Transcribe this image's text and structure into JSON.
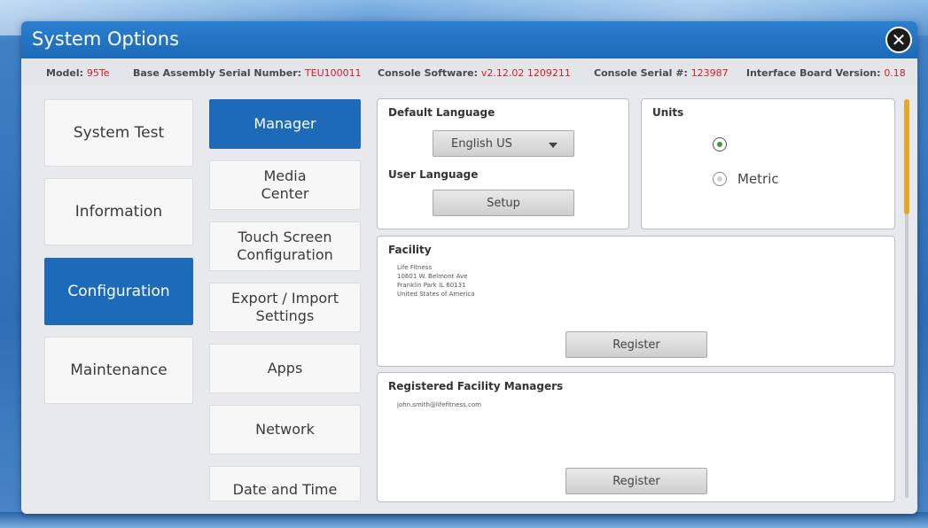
{
  "window": {
    "title": "System Options",
    "close_glyph": "✕"
  },
  "info": {
    "model_label": "Model: ",
    "model_value": "95Te",
    "serial_label": "Base Assembly Serial Number: ",
    "serial_value": "TEU100011",
    "software_label": "Console Software: ",
    "software_value": "v2.12.02 1209211",
    "console_serial_label": "Console Serial #: ",
    "console_serial_value": "123987",
    "interface_label": "Interface Board Version: ",
    "interface_value": "0.18"
  },
  "left_menu": [
    {
      "label": "System Test"
    },
    {
      "label": "Information"
    },
    {
      "label": "Configuration",
      "active": true
    },
    {
      "label": "Maintenance"
    }
  ],
  "sub_menu": [
    {
      "label": "Manager",
      "active": true
    },
    {
      "label": "Media\nCenter"
    },
    {
      "label": "Touch Screen\nConfiguration"
    },
    {
      "label": "Export / Import\nSettings"
    },
    {
      "label": "Apps"
    },
    {
      "label": "Network"
    },
    {
      "label": "Date and Time"
    }
  ],
  "language": {
    "default_title": "Default Language",
    "selected": "English US",
    "user_title": "User Language",
    "setup_label": "Setup"
  },
  "units": {
    "title": "Units",
    "metric_label": "Metric",
    "selected_index": 0
  },
  "facility": {
    "title": "Facility",
    "address": "Life Fitness\n10601 W. Belmont Ave\nFranklin Park IL 60131\nUnited States of America",
    "register_label": "Register"
  },
  "managers": {
    "title": "Registered Facility Managers",
    "email": "john.smith@lifefitness.com",
    "register_label": "Register"
  },
  "colors": {
    "accent": "#1c6ab8",
    "value_red": "#d0202a",
    "scroll_thumb": "#e5a72b"
  },
  "icons": {
    "close": "close-icon",
    "dropdown": "chevron-down-icon"
  }
}
